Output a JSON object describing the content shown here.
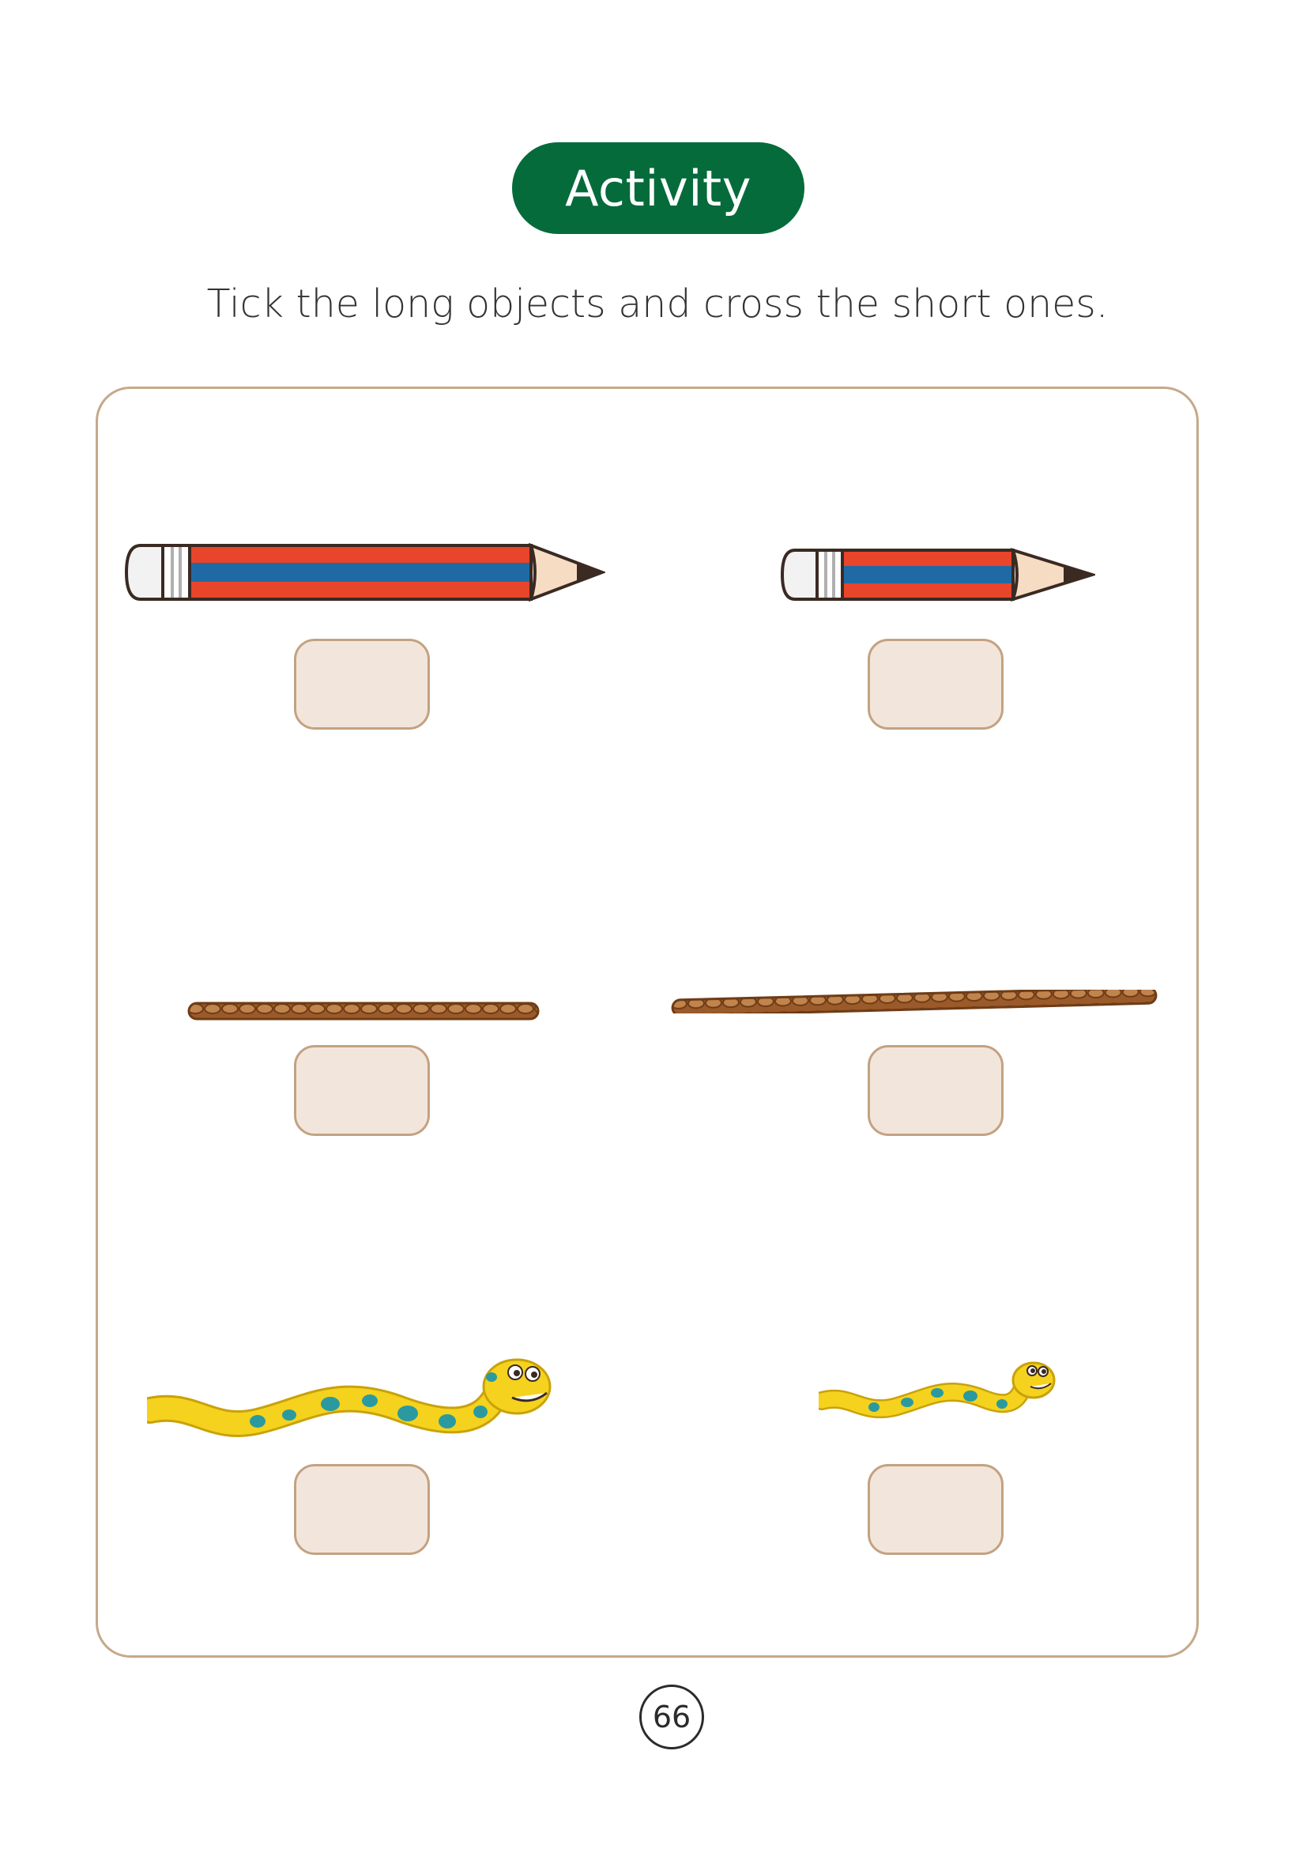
{
  "header": {
    "title": "Activity"
  },
  "instruction": "Tick the long objects and cross the short ones.",
  "items": [
    {
      "object_icon": "long-pencil-icon",
      "answer": ""
    },
    {
      "object_icon": "short-pencil-icon",
      "answer": ""
    },
    {
      "object_icon": "short-rope-icon",
      "answer": ""
    },
    {
      "object_icon": "long-rope-icon",
      "answer": ""
    },
    {
      "object_icon": "long-snake-icon",
      "answer": ""
    },
    {
      "object_icon": "short-snake-icon",
      "answer": ""
    }
  ],
  "footer": {
    "page_number": "66"
  },
  "colors": {
    "title_bg": "#056b3b",
    "panel_border": "#c5a98a",
    "answer_box_fill": "#f2e6dc",
    "pencil_red": "#e8452a",
    "pencil_blue": "#1f6aa5",
    "rope_brown": "#9b5a2a",
    "snake_yellow": "#f5d21e",
    "snake_spots": "#2a9aa0"
  }
}
